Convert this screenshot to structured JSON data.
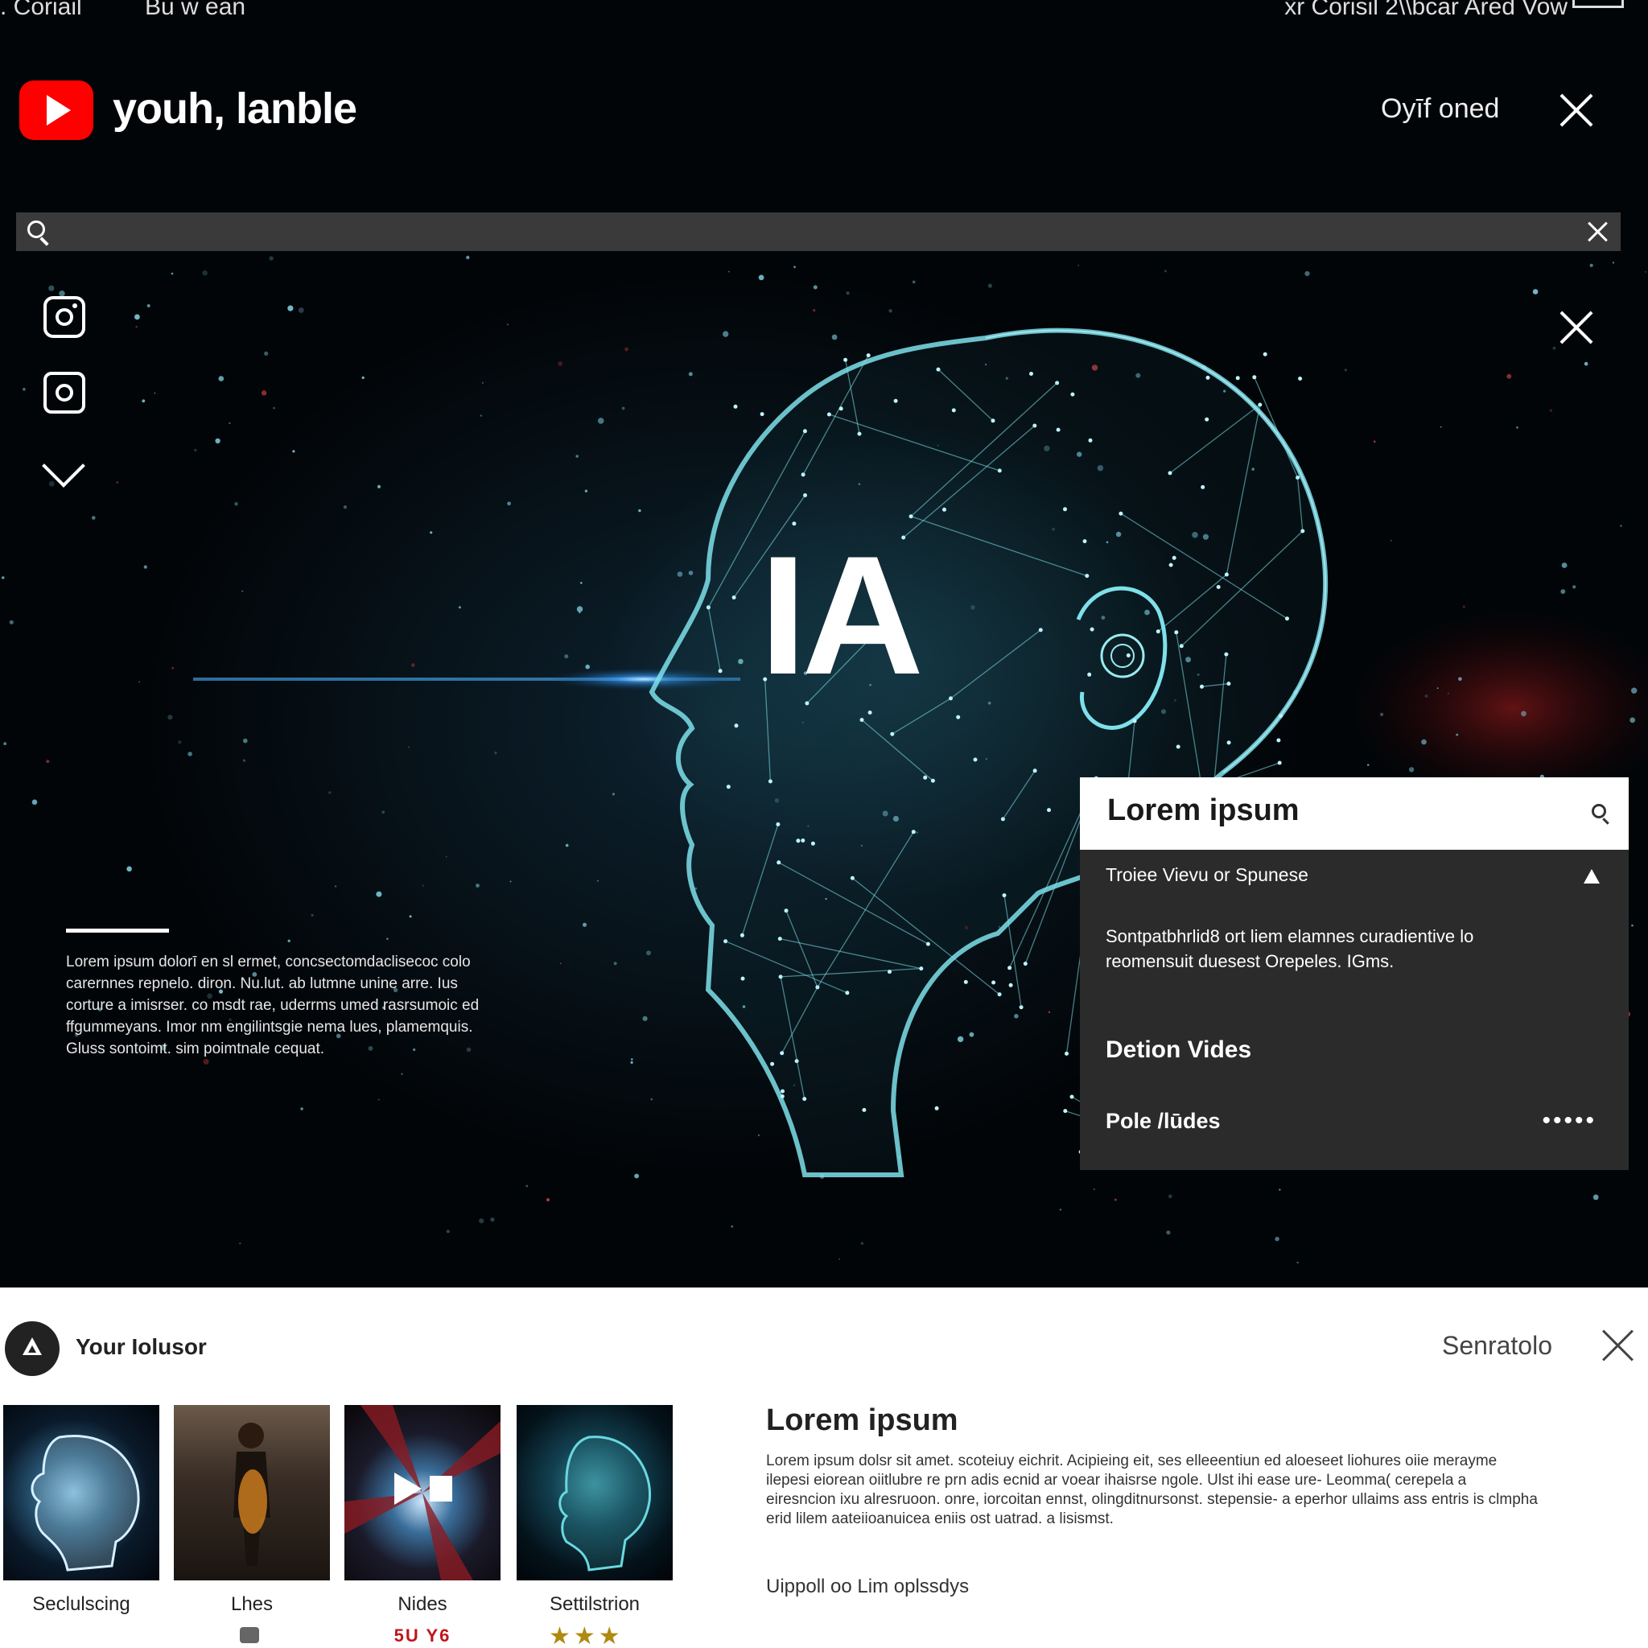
{
  "status_bar": {
    "left_1": ". Coriail",
    "left_2": "Bu w ean",
    "right": "ẍr Corisil  2\\\\bcar  Ared Vow"
  },
  "header": {
    "app_title": "youh, lanble",
    "right_label": "Oyīf oned"
  },
  "search": {
    "value": "",
    "placeholder": ""
  },
  "hero": {
    "big_text": "IA",
    "paragraph": "Lorem ipsum dolorī en sl ermet, concsectomdaclisecoc colo carernnes repnelo. diron. Nu.lut. ab lutmne unine arre. Ius corture a imisrser. co msdt rae, uderrms umed rasrsumoic ed ffgummeyans. Imor nm engilintsgie nema lues, plamemquis. Gluss  sontoimt. sim poimtnale cequat."
  },
  "panel": {
    "title": "Lorem ipsum",
    "row1": "Troiee Vievu or Spunese",
    "description": "Sontpatbhrlid8 ort liem elamnes curadientive lo reomensuit duesest Orepeles. IGms.",
    "row2": "Detion Vides",
    "row3": "Pole /lūdes",
    "dots": "•••••"
  },
  "sheet": {
    "title": "Your Iolusor",
    "right_label": "Senratolo",
    "thumbnails": [
      {
        "label": "Seclulscing",
        "sub": ""
      },
      {
        "label": "Lhes",
        "sub": ""
      },
      {
        "label": "Nides",
        "sub": "5U Y6"
      },
      {
        "label": "Settilstrion",
        "sub": ""
      }
    ],
    "stars": "★★★",
    "heading": "Lorem ipsum",
    "paragraph": "Lorem ipsum dolsr sit amet. scoteiuy eichrit. Acipieing eit, ses elleeentiun ed aloeseet liohures oiie merayme ilepesi eiorean oiitlubre re prn adis ecnid ar voear ihaisrse ngole. Ulst ihi ease ure- Leomma( cerepela a eiresncion ixu alresruoon. onre, iorcoitan ennst, olingditnursonst. stepensie- a eperhor ullaims ass entris is clmpha erid lilem aateiioanuicea eniis ost uatrad. a lisismst.",
    "link": "Uippoll oo Lim oplssdys"
  }
}
